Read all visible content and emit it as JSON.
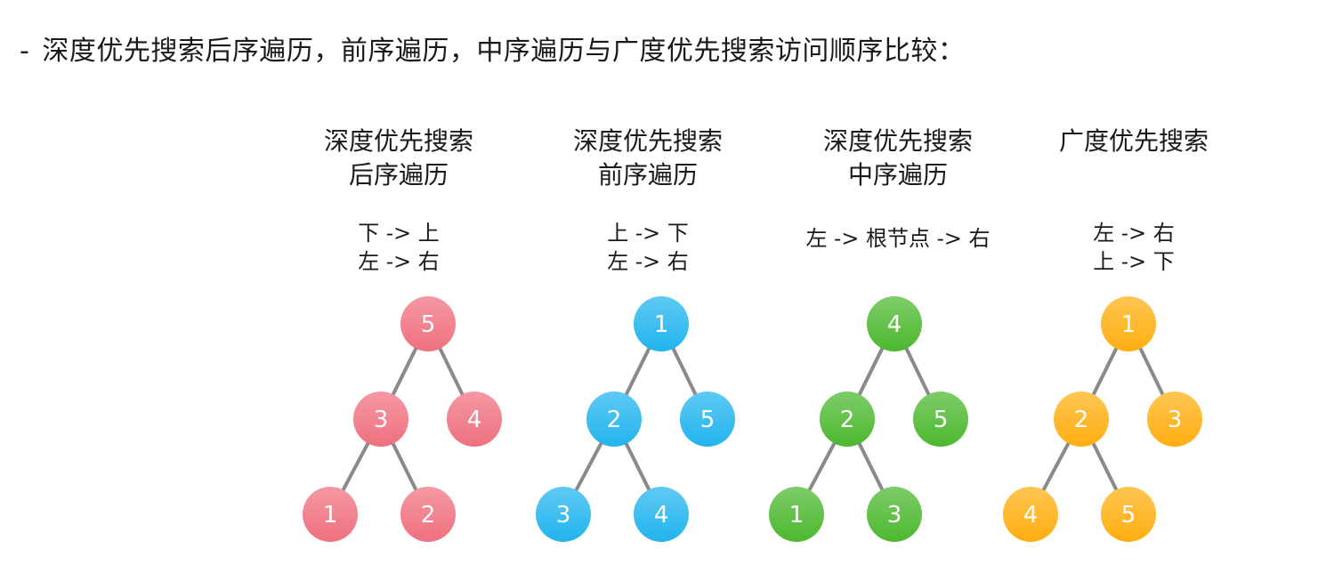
{
  "heading": {
    "dash": "-",
    "text": "深度优先搜索后序遍历，前序遍历，中序遍历与广度优先搜索访问顺序比较："
  },
  "colors": {
    "pink": "#f0707f",
    "cyan": "#22b4ee",
    "green": "#4cb82e",
    "orange": "#ffae10",
    "edge": "#8a8a8a"
  },
  "panels": [
    {
      "id": "postorder",
      "title_lines": [
        "深度优先搜索",
        "后序遍历"
      ],
      "rule_lines": [
        "下 -> 上",
        "左 -> 右"
      ],
      "color": "pink",
      "nodes": {
        "root": "5",
        "left": "3",
        "right": "4",
        "left_left": "1",
        "left_right": "2"
      }
    },
    {
      "id": "preorder",
      "title_lines": [
        "深度优先搜索",
        "前序遍历"
      ],
      "rule_lines": [
        "上 -> 下",
        "左 -> 右"
      ],
      "color": "cyan",
      "nodes": {
        "root": "1",
        "left": "2",
        "right": "5",
        "left_left": "3",
        "left_right": "4"
      }
    },
    {
      "id": "inorder",
      "title_lines": [
        "深度优先搜索",
        "中序遍历"
      ],
      "rule_lines": [
        "左 -> 根节点 -> 右"
      ],
      "color": "green",
      "nodes": {
        "root": "4",
        "left": "2",
        "right": "5",
        "left_left": "1",
        "left_right": "3"
      }
    },
    {
      "id": "bfs",
      "title_lines": [
        "广度优先搜索"
      ],
      "rule_lines": [
        "左 -> 右",
        "上 -> 下"
      ],
      "color": "orange",
      "nodes": {
        "root": "1",
        "left": "2",
        "right": "3",
        "left_left": "4",
        "left_right": "5"
      }
    }
  ]
}
